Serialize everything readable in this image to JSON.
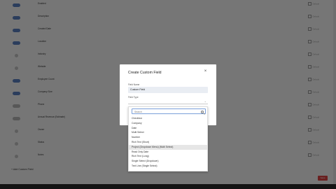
{
  "background": {
    "rows": [
      {
        "toggle": "on",
        "name": "Enabled",
        "meta": "Default"
      },
      {
        "toggle": "on",
        "name": "Description",
        "meta": "Default"
      },
      {
        "toggle": "on",
        "name": "Created Date",
        "meta": "Default"
      },
      {
        "toggle": "on",
        "name": "Location",
        "meta": "Default"
      },
      {
        "toggle": "dot",
        "name": "Industry",
        "meta": "Default"
      },
      {
        "toggle": "dot",
        "name": "Website",
        "meta": "Default"
      },
      {
        "toggle": "on",
        "name": "Employee Count",
        "meta": "Default"
      },
      {
        "toggle": "on",
        "name": "Company Size",
        "meta": "Default"
      },
      {
        "toggle": "off",
        "name": "Phone",
        "meta": "Default"
      },
      {
        "toggle": "off",
        "name": "Annual Revenue (Estimate)",
        "meta": "Default"
      },
      {
        "toggle": "dot",
        "name": "Owner",
        "meta": "Default"
      },
      {
        "toggle": "dot",
        "name": "Status",
        "meta": "Default"
      },
      {
        "toggle": "dot",
        "name": "Notes",
        "meta": "Default"
      }
    ],
    "add_field_label": "+ Add Custom Field",
    "bottom_left": "",
    "delete_label": "Save"
  },
  "modal": {
    "title": "Create Custom Field",
    "close_glyph": "×",
    "field_name_label": "Field Name",
    "field_name_value": "Custom Field",
    "field_type_label": "Field Type",
    "chevron_glyph": "⌄"
  },
  "dropdown": {
    "search_placeholder": "Search",
    "options": [
      {
        "label": "Checkbox",
        "highlighted": false
      },
      {
        "label": "Company",
        "highlighted": false
      },
      {
        "label": "Date",
        "highlighted": false
      },
      {
        "label": "Multi Select",
        "highlighted": false
      },
      {
        "label": "Number",
        "highlighted": false
      },
      {
        "label": "Rich Text (Short)",
        "highlighted": false
      },
      {
        "label": "Project (Dropdown Menu) (Multi Select)",
        "highlighted": true
      },
      {
        "label": "Read Only Date",
        "highlighted": false
      },
      {
        "label": "Rich Text (Long)",
        "highlighted": false
      },
      {
        "label": "Single Select (Dropdown)",
        "highlighted": false
      },
      {
        "label": "Text Line (Single Select)",
        "highlighted": false
      }
    ]
  },
  "colors": {
    "toggle_on": "#5a7fc0",
    "highlight": "#e6e6e6",
    "input_bg": "#e9edf3",
    "focus_border": "#7a9fd9"
  }
}
